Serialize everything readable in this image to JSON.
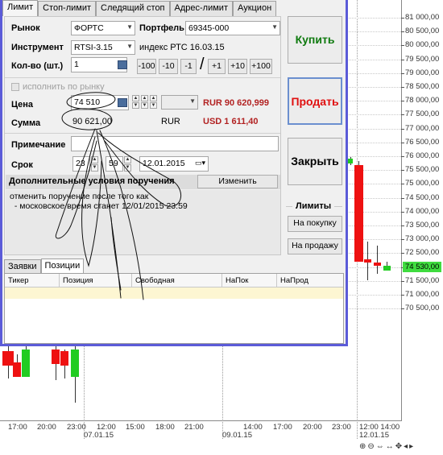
{
  "dialog": {
    "tabs": [
      "Лимит",
      "Стоп-лимит",
      "Следящий стоп",
      "Адрес-лимит",
      "Аукцион"
    ],
    "market_label": "Рынок",
    "market_value": "ФОРТС",
    "portfolio_label": "Портфель",
    "portfolio_value": "69345-000",
    "instrument_label": "Инструмент",
    "instrument_value": "RTSI-3.15",
    "instrument_desc": "индекс РТС 16.03.15",
    "qty_label": "Кол-во (шт.)",
    "qty_value": "1",
    "qty_buttons": [
      "-100",
      "-10",
      "-1",
      "/",
      "+1",
      "+10",
      "+100"
    ],
    "market_checkbox": "исполнить по рынку",
    "price_label": "Цена",
    "price_value": "74 510",
    "rur_value": "RUR 90 620,999",
    "sum_label": "Сумма",
    "sum_value": "90 621,00",
    "sum_currency": "RUR",
    "usd_value": "USD 1 611,40",
    "note_label": "Примечание",
    "note_value": "",
    "term_label": "Срок",
    "term_hour": "23",
    "term_min": "59",
    "term_date": "12.01.2015",
    "cond_label": "Дополнительные условия поручения",
    "cond_button": "Изменить",
    "cond_line1": "отменить поручение после того как",
    "cond_line2": "  - московское время станет 12/01/2015 23:59",
    "buy": "Купить",
    "sell": "Продать",
    "close": "Закрыть",
    "limits": "Лимиты",
    "limit_buy": "На покупку",
    "limit_sell": "На продажу",
    "bottom_tabs": [
      "Заявки",
      "Позиции"
    ],
    "table_headers": [
      "Тикер",
      "Позиция",
      "Свободная",
      "НаПок",
      "НаПрод"
    ]
  },
  "chart": {
    "price_labels": [
      "81 000,00",
      "80 500,00",
      "80 000,00",
      "79 500,00",
      "79 000,00",
      "78 500,00",
      "78 000,00",
      "77 500,00",
      "77 000,00",
      "76 500,00",
      "76 000,00",
      "75 500,00",
      "75 000,00",
      "74 500,00",
      "74 000,00",
      "73 500,00",
      "73 000,00",
      "72 500,00",
      "72 000,00",
      "71 500,00",
      "71 000,00",
      "70 500,00"
    ],
    "current_price": "74 530,00",
    "time_labels": [
      "17:00",
      "20:00",
      "23:00",
      "12:00",
      "15:00",
      "18:00",
      "21:00",
      "14:00",
      "17:00",
      "20:00",
      "23:00",
      "12:00 14:00"
    ],
    "date_labels": [
      "07.01.15",
      "09.01.15",
      "12.01.15"
    ],
    "colors": {
      "up": "#22cc22",
      "down": "#ee1111",
      "accent": "#5b5bd8"
    }
  }
}
